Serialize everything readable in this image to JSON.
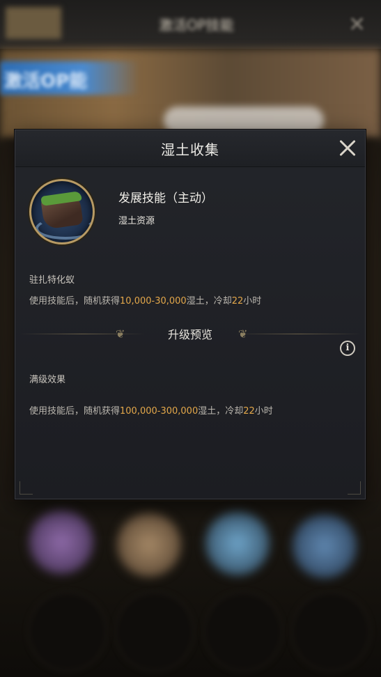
{
  "background": {
    "top_title": "激活OP技能",
    "banner_text": "激活OP能"
  },
  "dialog": {
    "title": "湿土收集",
    "close_icon": "close-icon",
    "skill": {
      "icon": "wet-soil-rock-icon",
      "name": "发展技能（主动）",
      "resource": "湿土资源"
    },
    "current": {
      "label": "驻扎特化蚁",
      "desc_prefix": "使用技能后，随机获得",
      "desc_range": "10,000-30,000",
      "desc_middle": "湿土，冷却",
      "desc_hours": "22",
      "desc_suffix": "小时"
    },
    "upgrade": {
      "title": "升级预览",
      "info_icon": "info-icon",
      "info_glyph": "i",
      "max_label": "满级效果",
      "desc_prefix": "使用技能后，随机获得",
      "desc_range": "100,000-300,000",
      "desc_middle": "湿土，冷却",
      "desc_hours": "22",
      "desc_suffix": "小时"
    }
  },
  "colors": {
    "highlight": "#e4a84a",
    "dialog_bg": "#1f2025",
    "icon_border": "#b79a64"
  }
}
